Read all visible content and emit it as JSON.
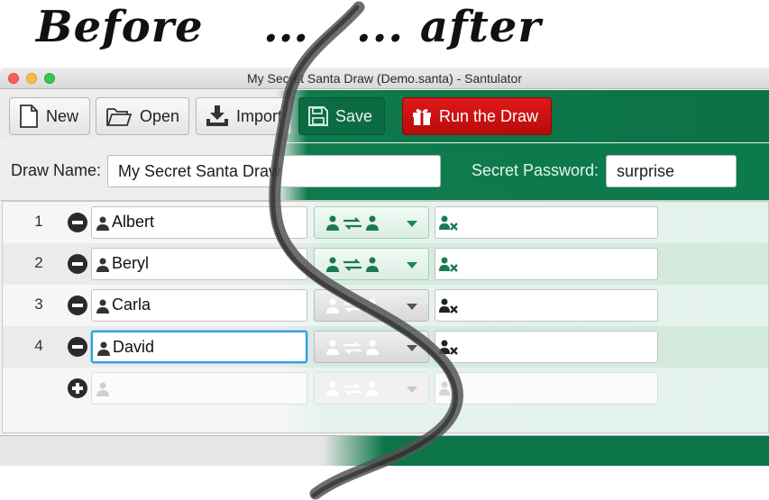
{
  "caption": {
    "before": "Before",
    "dots_left": "...",
    "dots_right": "...",
    "after": "after"
  },
  "window": {
    "title": "My Secret Santa Draw (Demo.santa) - Santulator"
  },
  "toolbar": {
    "new_label": "New",
    "open_label": "Open",
    "import_label": "Import",
    "save_label": "Save",
    "run_label": "Run the Draw"
  },
  "draw": {
    "name_label": "Draw Name:",
    "name_value": "My Secret Santa Draw",
    "password_label": "Secret Password:",
    "password_value": "surprise"
  },
  "participants": [
    {
      "number": "1",
      "name": "Albert"
    },
    {
      "number": "2",
      "name": "Beryl"
    },
    {
      "number": "3",
      "name": "Carla"
    },
    {
      "number": "4",
      "name": "David"
    }
  ],
  "colors": {
    "accent_green": "#0f7a4d",
    "run_red": "#d41212",
    "focus_blue": "#2f9ee0"
  },
  "icons": [
    "window-close-icon",
    "window-minimize-icon",
    "window-maximize-icon",
    "new-file-icon",
    "open-folder-icon",
    "import-icon",
    "save-icon",
    "gift-icon",
    "remove-icon",
    "add-icon",
    "person-icon",
    "swap-pair-icon",
    "exclude-person-icon"
  ]
}
